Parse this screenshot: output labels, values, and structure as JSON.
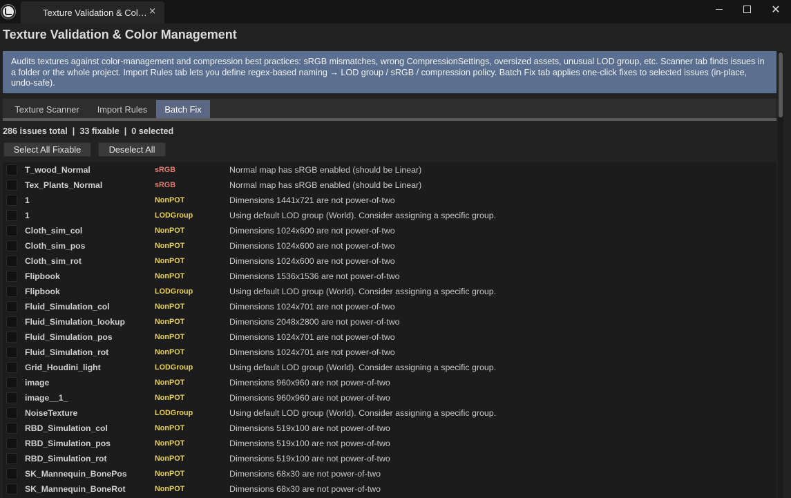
{
  "window": {
    "tab_title": "Texture Validation & Col…",
    "close_tab_glyph": "×",
    "close_glyph": "✕",
    "icons": [
      "unreal-logo-icon",
      "minimize-icon",
      "maximize-icon",
      "close-icon"
    ]
  },
  "page": {
    "title": "Texture Validation & Color Management",
    "description": "Audits textures against color-management and compression best practices: sRGB mismatches, wrong CompressionSettings, oversized assets, unusual LOD group, etc. Scanner tab finds issues in a folder or the whole project. Import Rules tab lets you define regex-based naming → LOD group / sRGB / compression policy. Batch Fix tab applies one-click fixes to selected issues (in-place, undo-safe)."
  },
  "tabs": [
    {
      "label": "Texture Scanner",
      "active": false
    },
    {
      "label": "Import Rules",
      "active": false
    },
    {
      "label": "Batch Fix",
      "active": true
    }
  ],
  "summary": "286 issues total  |  33 fixable  |  0 selected",
  "buttons": {
    "select_all_fixable": "Select All Fixable",
    "deselect_all": "Deselect All"
  },
  "colors": {
    "sRGB": "#e87a6e",
    "NonPOT": "#e8d25c",
    "LODGroup": "#e8d25c",
    "accent_tab": "#5c6784",
    "description_bg": "#5b7090"
  },
  "issues": [
    {
      "name": "T_wood_Normal",
      "type": "sRGB",
      "message": "Normal map has sRGB enabled (should be Linear)",
      "checked": false
    },
    {
      "name": "Tex_Plants_Normal",
      "type": "sRGB",
      "message": "Normal map has sRGB enabled (should be Linear)",
      "checked": false
    },
    {
      "name": "1",
      "type": "NonPOT",
      "message": "Dimensions 1441x721 are not power-of-two",
      "checked": false
    },
    {
      "name": "1",
      "type": "LODGroup",
      "message": "Using default LOD group (World). Consider assigning a specific group.",
      "checked": false
    },
    {
      "name": "Cloth_sim_col",
      "type": "NonPOT",
      "message": "Dimensions 1024x600 are not power-of-two",
      "checked": false
    },
    {
      "name": "Cloth_sim_pos",
      "type": "NonPOT",
      "message": "Dimensions 1024x600 are not power-of-two",
      "checked": false
    },
    {
      "name": "Cloth_sim_rot",
      "type": "NonPOT",
      "message": "Dimensions 1024x600 are not power-of-two",
      "checked": false
    },
    {
      "name": "Flipbook",
      "type": "NonPOT",
      "message": "Dimensions 1536x1536 are not power-of-two",
      "checked": false
    },
    {
      "name": "Flipbook",
      "type": "LODGroup",
      "message": "Using default LOD group (World). Consider assigning a specific group.",
      "checked": false
    },
    {
      "name": "Fluid_Simulation_col",
      "type": "NonPOT",
      "message": "Dimensions 1024x701 are not power-of-two",
      "checked": false
    },
    {
      "name": "Fluid_Simulation_lookup",
      "type": "NonPOT",
      "message": "Dimensions 2048x2800 are not power-of-two",
      "checked": false
    },
    {
      "name": "Fluid_Simulation_pos",
      "type": "NonPOT",
      "message": "Dimensions 1024x701 are not power-of-two",
      "checked": false
    },
    {
      "name": "Fluid_Simulation_rot",
      "type": "NonPOT",
      "message": "Dimensions 1024x701 are not power-of-two",
      "checked": false
    },
    {
      "name": "Grid_Houdini_light",
      "type": "LODGroup",
      "message": "Using default LOD group (World). Consider assigning a specific group.",
      "checked": false
    },
    {
      "name": "image",
      "type": "NonPOT",
      "message": "Dimensions 960x960 are not power-of-two",
      "checked": false
    },
    {
      "name": "image__1_",
      "type": "NonPOT",
      "message": "Dimensions 960x960 are not power-of-two",
      "checked": false
    },
    {
      "name": "NoiseTexture",
      "type": "LODGroup",
      "message": "Using default LOD group (World). Consider assigning a specific group.",
      "checked": false
    },
    {
      "name": "RBD_Simulation_col",
      "type": "NonPOT",
      "message": "Dimensions 519x100 are not power-of-two",
      "checked": false
    },
    {
      "name": "RBD_Simulation_pos",
      "type": "NonPOT",
      "message": "Dimensions 519x100 are not power-of-two",
      "checked": false
    },
    {
      "name": "RBD_Simulation_rot",
      "type": "NonPOT",
      "message": "Dimensions 519x100 are not power-of-two",
      "checked": false
    },
    {
      "name": "SK_Mannequin_BonePos",
      "type": "NonPOT",
      "message": "Dimensions 68x30 are not power-of-two",
      "checked": false
    },
    {
      "name": "SK_Mannequin_BoneRot",
      "type": "NonPOT",
      "message": "Dimensions 68x30 are not power-of-two",
      "checked": false
    }
  ]
}
